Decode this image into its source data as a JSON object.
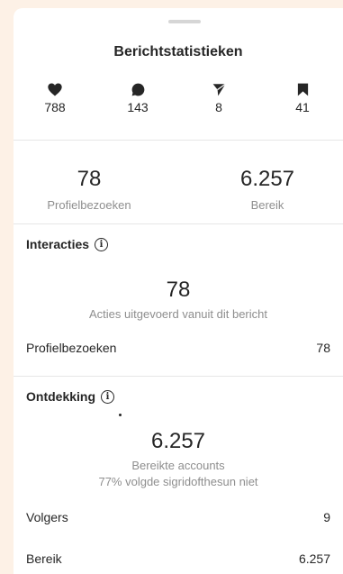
{
  "sheet": {
    "title": "Berichtstatistieken"
  },
  "top_stats": [
    {
      "icon": "heart-icon",
      "value": "788"
    },
    {
      "icon": "comment-icon",
      "value": "143"
    },
    {
      "icon": "send-icon",
      "value": "8"
    },
    {
      "icon": "bookmark-icon",
      "value": "41"
    }
  ],
  "summary": {
    "profile_visits": {
      "value": "78",
      "label": "Profielbezoeken"
    },
    "reach": {
      "value": "6.257",
      "label": "Bereik"
    }
  },
  "interactions": {
    "title": "Interacties",
    "total": "78",
    "subtitle": "Acties uitgevoerd vanuit dit bericht",
    "rows": [
      {
        "label": "Profielbezoeken",
        "value": "78"
      }
    ]
  },
  "discovery": {
    "title": "Ontdekking",
    "total": "6.257",
    "subtitle": "Bereikte accounts",
    "subtitle2": "77% volgde sigridofthesun niet",
    "rows": [
      {
        "label": "Volgers",
        "value": "9"
      },
      {
        "label": "Bereik",
        "value": "6.257"
      }
    ]
  },
  "colors": {
    "background": "#fdf1e6",
    "sheet": "#ffffff",
    "muted_text": "#8e8e8e",
    "divider": "#e6e6e6"
  }
}
